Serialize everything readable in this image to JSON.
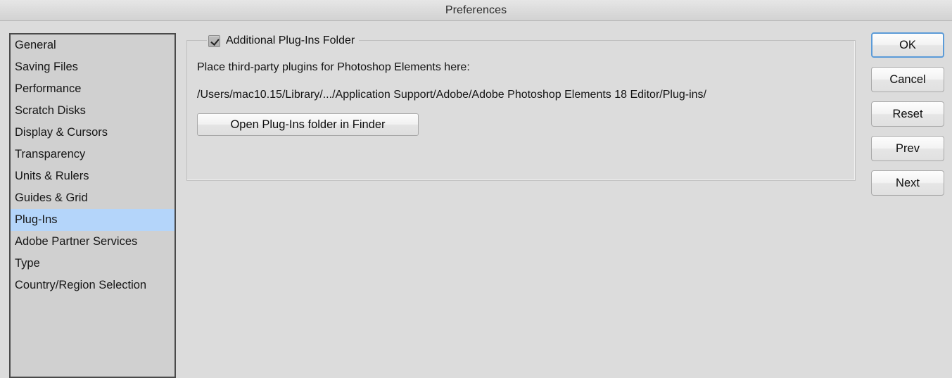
{
  "window": {
    "title": "Preferences"
  },
  "sidebar": {
    "items": [
      {
        "label": "General",
        "selected": false
      },
      {
        "label": "Saving Files",
        "selected": false
      },
      {
        "label": "Performance",
        "selected": false
      },
      {
        "label": "Scratch Disks",
        "selected": false
      },
      {
        "label": "Display & Cursors",
        "selected": false
      },
      {
        "label": "Transparency",
        "selected": false
      },
      {
        "label": "Units & Rulers",
        "selected": false
      },
      {
        "label": "Guides & Grid",
        "selected": false
      },
      {
        "label": "Plug-Ins",
        "selected": true
      },
      {
        "label": "Adobe Partner Services",
        "selected": false
      },
      {
        "label": "Type",
        "selected": false
      },
      {
        "label": "Country/Region Selection",
        "selected": false
      }
    ]
  },
  "panel": {
    "group_title": "Additional Plug-Ins Folder",
    "checkbox_checked": true,
    "checkbox_icon": "checkmark-icon",
    "hint_text": "Place third-party plugins for Photoshop Elements here:",
    "path_text": "/Users/mac10.15/Library/.../Application Support/Adobe/Adobe Photoshop Elements 18 Editor/Plug-ins/",
    "open_folder_label": "Open Plug-Ins folder in Finder"
  },
  "buttons": [
    {
      "label": "OK",
      "default": true
    },
    {
      "label": "Cancel",
      "default": false
    },
    {
      "label": "Reset",
      "default": false
    },
    {
      "label": "Prev",
      "default": false
    },
    {
      "label": "Next",
      "default": false
    }
  ],
  "colors": {
    "dialog_background": "#dcdcdc",
    "list_background": "#d0d0d0",
    "list_border": "#4a4a4a",
    "selection_highlight": "#b4d5fa",
    "default_button_border": "#5b9bd8",
    "text": "#141414"
  }
}
